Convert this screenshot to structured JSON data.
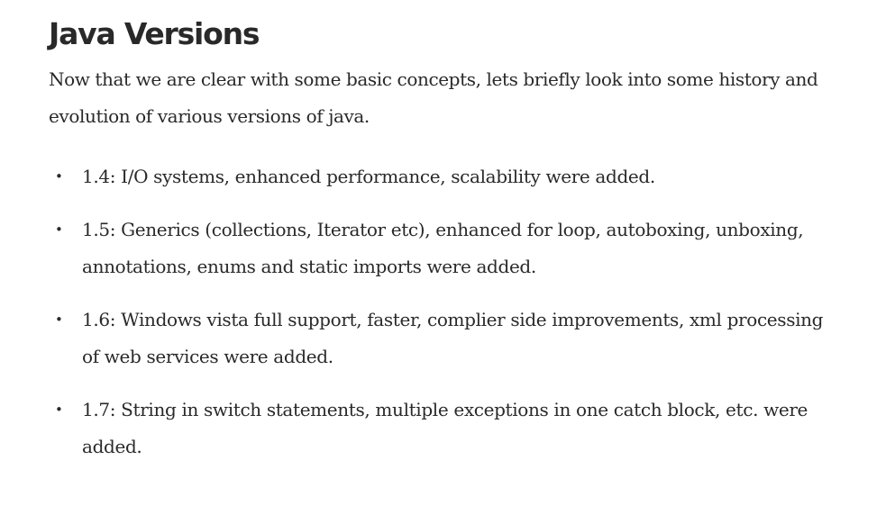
{
  "article": {
    "title": "Java Versions",
    "intro": "Now that we are clear with some basic concepts, lets briefly look into some history and evolution of various versions of java.",
    "bullet_glyph": "•",
    "versions": [
      "1.4: I/O systems, enhanced performance, scalability were added.",
      "1.5: Generics (collections, Iterator etc), enhanced for loop, autoboxing, unboxing, annotations, enums and static imports were added.",
      "1.6: Windows vista full support, faster, complier side improvements, xml processing of web services were added.",
      "1.7: String in switch statements, multiple exceptions in one catch block, etc. were added."
    ]
  }
}
